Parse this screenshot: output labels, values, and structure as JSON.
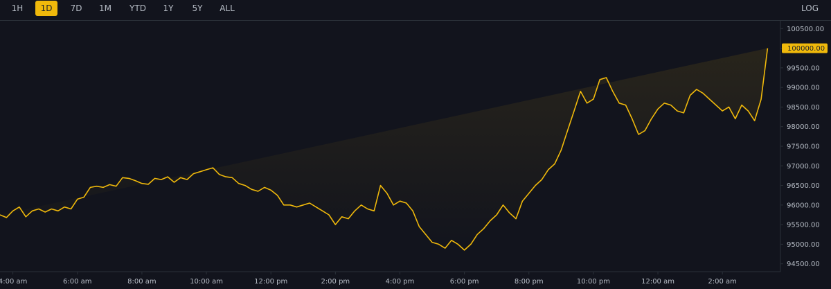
{
  "toolbar": {
    "ranges": [
      "1H",
      "1D",
      "7D",
      "1M",
      "YTD",
      "1Y",
      "5Y",
      "ALL"
    ],
    "active": "1D",
    "log_label": "LOG"
  },
  "current_price_label": "100000.00",
  "colors": {
    "line": "#f0b90b",
    "background": "#12141d",
    "axis": "#2b3139",
    "text": "#b7bdc6"
  },
  "chart_data": {
    "type": "line",
    "y_ticks": [
      "100500.00",
      "100000.00",
      "99500.00",
      "99000.00",
      "98500.00",
      "98000.00",
      "97500.00",
      "97000.00",
      "96500.00",
      "96000.00",
      "95500.00",
      "95000.00",
      "94500.00"
    ],
    "y_tick_values": [
      100500,
      100000,
      99500,
      99000,
      98500,
      98000,
      97500,
      97000,
      96500,
      96000,
      95500,
      95000,
      94500
    ],
    "ylim": [
      94300,
      100700
    ],
    "x_ticks": [
      "4:00 am",
      "6:00 am",
      "8:00 am",
      "10:00 am",
      "12:00 pm",
      "2:00 pm",
      "4:00 pm",
      "6:00 pm",
      "8:00 pm",
      "10:00 pm",
      "12:00 am",
      "2:00 am"
    ],
    "x_tick_hours": [
      4,
      6,
      8,
      10,
      12,
      14,
      16,
      18,
      20,
      22,
      24,
      26
    ],
    "xlim_hours": [
      3.6,
      27.8
    ],
    "x_hours": [
      3.6,
      3.8,
      4.0,
      4.2,
      4.4,
      4.6,
      4.8,
      5.0,
      5.2,
      5.4,
      5.6,
      5.8,
      6.0,
      6.2,
      6.4,
      6.6,
      6.8,
      7.0,
      7.2,
      7.4,
      7.6,
      7.8,
      8.0,
      8.2,
      8.4,
      8.6,
      8.8,
      9.0,
      9.2,
      9.4,
      9.6,
      9.8,
      10.0,
      10.2,
      10.4,
      10.6,
      10.8,
      11.0,
      11.2,
      11.4,
      11.6,
      11.8,
      12.0,
      12.2,
      12.4,
      12.6,
      12.8,
      13.0,
      13.2,
      13.4,
      13.6,
      13.8,
      14.0,
      14.2,
      14.4,
      14.6,
      14.8,
      15.0,
      15.2,
      15.4,
      15.6,
      15.8,
      16.0,
      16.2,
      16.4,
      16.6,
      16.8,
      17.0,
      17.2,
      17.4,
      17.6,
      17.8,
      18.0,
      18.2,
      18.4,
      18.6,
      18.8,
      19.0,
      19.2,
      19.4,
      19.6,
      19.8,
      20.0,
      20.2,
      20.4,
      20.6,
      20.8,
      21.0,
      21.2,
      21.4,
      21.6,
      21.8,
      22.0,
      22.2,
      22.4,
      22.6,
      22.8,
      23.0,
      23.2,
      23.4,
      23.6,
      23.8,
      24.0,
      24.2,
      24.4,
      24.6,
      24.8,
      25.0,
      25.2,
      25.4,
      25.6,
      25.8,
      26.0,
      26.2,
      26.4,
      26.6,
      26.8,
      27.0,
      27.2,
      27.4,
      27.6
    ],
    "y_values": [
      95750,
      95680,
      95850,
      95950,
      95700,
      95850,
      95900,
      95820,
      95900,
      95850,
      95950,
      95900,
      96150,
      96200,
      96450,
      96480,
      96450,
      96520,
      96480,
      96700,
      96680,
      96620,
      96550,
      96530,
      96680,
      96650,
      96720,
      96580,
      96700,
      96650,
      96800,
      96850,
      96900,
      96950,
      96780,
      96720,
      96700,
      96550,
      96500,
      96400,
      96350,
      96450,
      96380,
      96250,
      96000,
      96000,
      95950,
      96000,
      96050,
      95950,
      95850,
      95750,
      95500,
      95700,
      95650,
      95850,
      96000,
      95900,
      95850,
      96500,
      96300,
      96000,
      96100,
      96050,
      95850,
      95450,
      95250,
      95050,
      95000,
      94900,
      95100,
      95000,
      94850,
      95000,
      95250,
      95400,
      95600,
      95750,
      96000,
      95800,
      95650,
      96100,
      96300,
      96500,
      96650,
      96900,
      97050,
      97400,
      97900,
      98400,
      98900,
      98600,
      98700,
      99200,
      99250,
      98900,
      98600,
      98550,
      98200,
      97800,
      97900,
      98200,
      98450,
      98600,
      98550,
      98400,
      98350,
      98800,
      98950,
      98850,
      98700,
      98550,
      98400,
      98500,
      98200,
      98550,
      98400,
      98150,
      98700,
      100000
    ]
  }
}
